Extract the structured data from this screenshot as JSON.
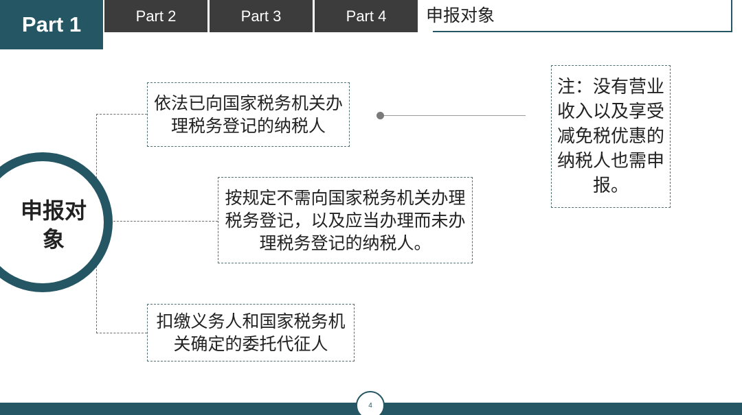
{
  "nav": {
    "active": "Part 1",
    "tabs": [
      "Part 2",
      "Part 3",
      "Part 4"
    ]
  },
  "section_title": "申报对象",
  "ring_label": "申报对象",
  "items": [
    "依法已向国家税务机关办理税务登记的纳税人",
    "按规定不需向国家税务机关办理税务登记，以及应当办理而未办理税务登记的纳税人。",
    "扣缴义务人和国家税务机关确定的委托代征人"
  ],
  "note": "注：没有营业收入以及享受减免税优惠的纳税人也需申报。",
  "page_number": "4",
  "colors": {
    "accent": "#255664",
    "tab_background": "#3c3c3c"
  }
}
